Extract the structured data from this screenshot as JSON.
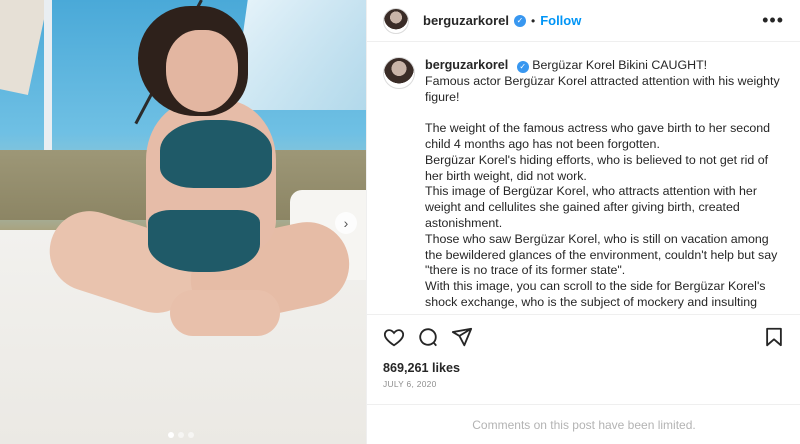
{
  "post": {
    "username": "berguzarkorel",
    "follow_label": "Follow",
    "separator": "•",
    "more_label": "•••",
    "caption_lines_1": [
      "Bergüzar Korel Bikini CAUGHT!",
      "Famous actor Bergüzar Korel attracted attention with his weighty figure!"
    ],
    "caption_paragraph_2": [
      "The weight of the famous actress who gave birth to her second child 4 months ago has not been forgotten.",
      "Bergüzar Korel's hiding efforts, who is believed to not get rid of her birth weight, did not work.",
      "This image of Bergüzar Korel, who attracts attention with her weight and cellulites she gained after giving birth, created astonishment.",
      "Those who saw Bergüzar Korel, who is still on vacation among the bewildered glances of the environment, couldn't help but say \"there is no trace of its former state\".",
      "With this image, you can scroll to the side for Bergüzar Korel's shock exchange, who is the subject of mockery and insulting"
    ],
    "likes": "869,261 likes",
    "date": "JULY 6, 2020",
    "comments_limited": "Comments on this post have been limited."
  },
  "carousel": {
    "next_icon": "chevron-right-icon",
    "dot_count": 3,
    "active_index": 0
  },
  "icons": {
    "like": "heart-icon",
    "comment": "comment-icon",
    "share": "paper-plane-icon",
    "save": "bookmark-icon",
    "verified": "verified-badge-icon"
  },
  "colors": {
    "accent": "#0095f6",
    "verified": "#3897f0",
    "muted": "#8e8e8e"
  }
}
